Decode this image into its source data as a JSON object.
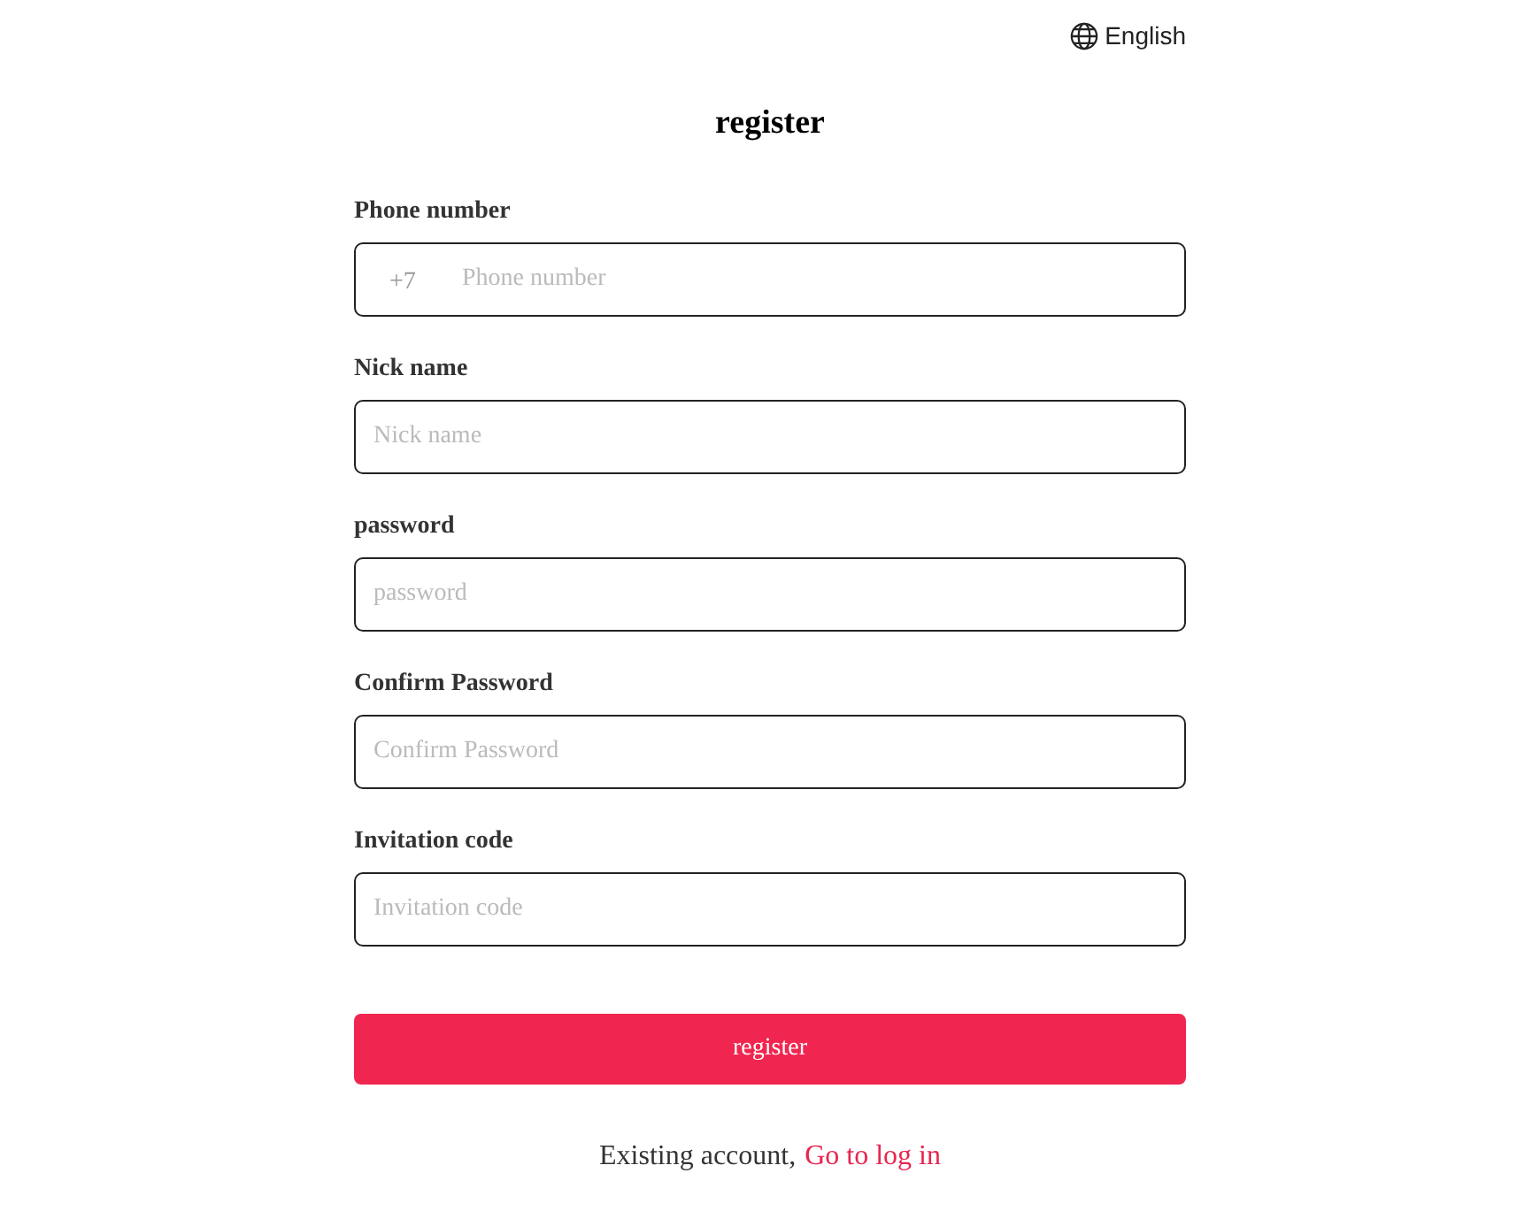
{
  "language": {
    "label": "English"
  },
  "title": "register",
  "fields": [
    {
      "label": "Phone number",
      "prefix": "+7",
      "placeholder": "Phone number"
    },
    {
      "label": "Nick name",
      "placeholder": "Nick name"
    },
    {
      "label": "password",
      "placeholder": "password"
    },
    {
      "label": "Confirm Password",
      "placeholder": "Confirm Password"
    },
    {
      "label": "Invitation code",
      "placeholder": "Invitation code"
    }
  ],
  "submit": "register",
  "footer": {
    "text": "Existing account,",
    "link": "Go to log in"
  }
}
